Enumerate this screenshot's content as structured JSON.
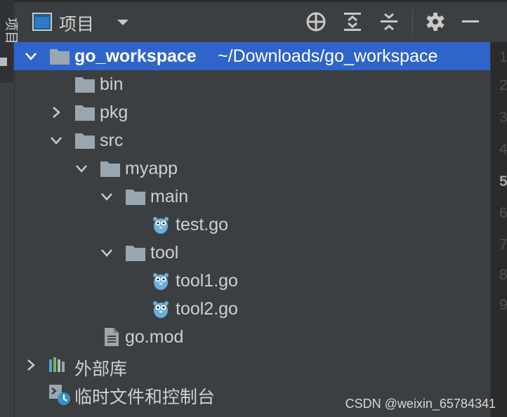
{
  "side_stripe": {
    "label": "项目"
  },
  "header": {
    "title": "项目",
    "buttons": [
      {
        "name": "locate-icon"
      },
      {
        "name": "expand-all-icon"
      },
      {
        "name": "collapse-all-icon"
      },
      {
        "name": "gear-icon"
      },
      {
        "name": "hide-icon"
      }
    ]
  },
  "tree": {
    "root": {
      "name": "go_workspace",
      "path": "~/Downloads/go_workspace"
    },
    "items": [
      {
        "label": "bin"
      },
      {
        "label": "pkg"
      },
      {
        "label": "src"
      },
      {
        "label": "myapp"
      },
      {
        "label": "main"
      },
      {
        "label": "test.go"
      },
      {
        "label": "tool"
      },
      {
        "label": "tool1.go"
      },
      {
        "label": "tool2.go"
      },
      {
        "label": "go.mod"
      },
      {
        "label": "外部库"
      },
      {
        "label": "临时文件和控制台"
      }
    ]
  },
  "gutter": {
    "line_numbers": [
      "1",
      "2",
      "3",
      "4",
      "5",
      "6",
      "7",
      "8",
      "9"
    ],
    "current_line": "5"
  },
  "colors": {
    "selection": "#2f65ca",
    "background": "#3c3f41",
    "folder": "#9aa7b0",
    "gopher": "#6ab0de"
  },
  "watermark": "CSDN @weixin_65784341"
}
